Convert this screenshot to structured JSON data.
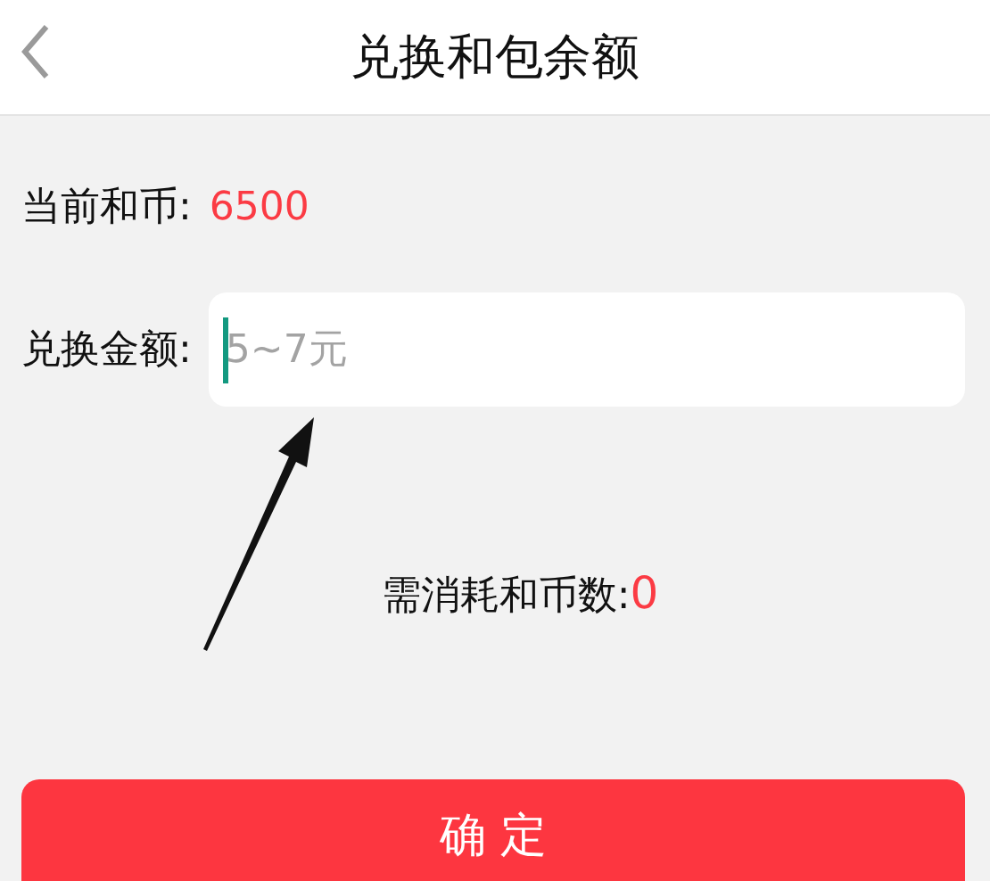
{
  "header": {
    "title": "兑换和包余额"
  },
  "balance": {
    "label": "当前和币:",
    "value": "6500"
  },
  "amount_field": {
    "label": "兑换金额:",
    "placeholder": "5~7元",
    "focused": true
  },
  "cost": {
    "label": "需消耗和币数:",
    "value": "0"
  },
  "confirm_button": {
    "label": "确 定"
  }
}
